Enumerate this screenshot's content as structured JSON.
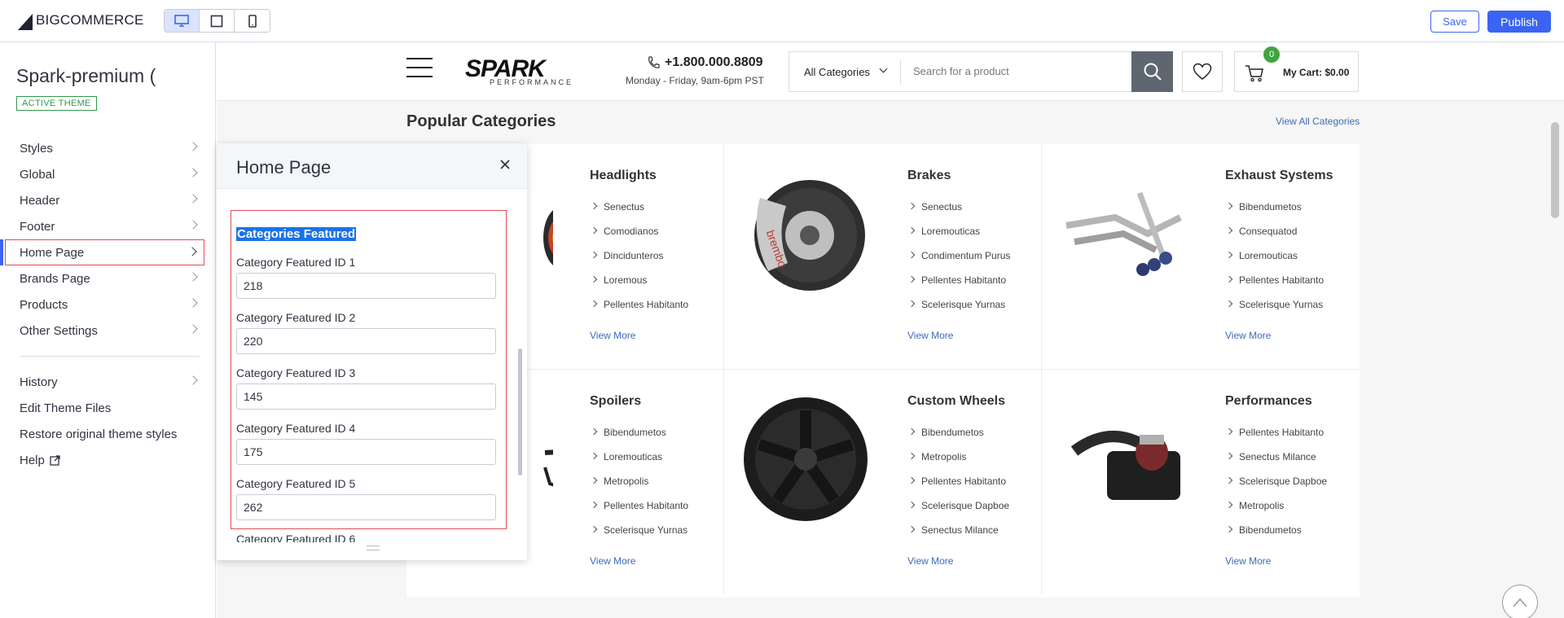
{
  "topbar": {
    "logo_big": "BIG",
    "logo_commerce": "COMMERCE",
    "devices": [
      "desktop-icon",
      "tablet-icon",
      "mobile-icon"
    ],
    "save_label": "Save",
    "publish_label": "Publish",
    "accent": "#3c64f4"
  },
  "sidebar": {
    "theme_name": "Spark-premium (",
    "badge": "ACTIVE THEME",
    "items": [
      {
        "label": "Styles"
      },
      {
        "label": "Global"
      },
      {
        "label": "Header"
      },
      {
        "label": "Footer"
      },
      {
        "label": "Home Page"
      },
      {
        "label": "Brands Page"
      },
      {
        "label": "Products"
      },
      {
        "label": "Other Settings"
      }
    ],
    "secondary": [
      {
        "label": "History"
      },
      {
        "label": "Edit Theme Files"
      },
      {
        "label": "Restore original theme styles"
      },
      {
        "label": "Help"
      }
    ]
  },
  "panel": {
    "title": "Home Page",
    "section_title": "Categories Featured",
    "fields": [
      {
        "label": "Category Featured ID 1",
        "value": "218"
      },
      {
        "label": "Category Featured ID 2",
        "value": "220"
      },
      {
        "label": "Category Featured ID 3",
        "value": "145"
      },
      {
        "label": "Category Featured ID 4",
        "value": "175"
      },
      {
        "label": "Category Featured ID 5",
        "value": "262"
      }
    ],
    "cut_label": "Category Featured ID 6"
  },
  "store": {
    "logo_word": "SPARK",
    "logo_sub": "PERFORMANCE",
    "phone": "+1.800.000.8809",
    "hours": "Monday - Friday, 9am-6pm PST",
    "search_category": "All Categories",
    "search_placeholder": "Search for a product",
    "cart_count": "0",
    "cart_label": "My Cart: $0.00",
    "popular_title": "Popular Categories",
    "view_all": "View All Categories",
    "view_more": "View More",
    "categories": [
      {
        "title": "Headlights",
        "items": [
          "Senectus",
          "Comodianos",
          "Dincidunteros",
          "Loremous",
          "Pellentes Habitanto"
        ]
      },
      {
        "title": "Brakes",
        "items": [
          "Senectus",
          "Loremouticas",
          "Condimentum Purus",
          "Pellentes Habitanto",
          "Scelerisque Yurnas"
        ]
      },
      {
        "title": "Exhaust Systems",
        "items": [
          "Bibendumetos",
          "Consequatod",
          "Loremouticas",
          "Pellentes Habitanto",
          "Scelerisque Yurnas"
        ]
      },
      {
        "title": "Spoilers",
        "items": [
          "Bibendumetos",
          "Loremouticas",
          "Metropolis",
          "Pellentes Habitanto",
          "Scelerisque Yurnas"
        ]
      },
      {
        "title": "Custom Wheels",
        "items": [
          "Bibendumetos",
          "Metropolis",
          "Pellentes Habitanto",
          "Scelerisque Dapboe",
          "Senectus Milance"
        ]
      },
      {
        "title": "Performances",
        "items": [
          "Pellentes Habitanto",
          "Senectus Milance",
          "Scelerisque Dapboe",
          "Metropolis",
          "Bibendumetos"
        ]
      }
    ]
  }
}
